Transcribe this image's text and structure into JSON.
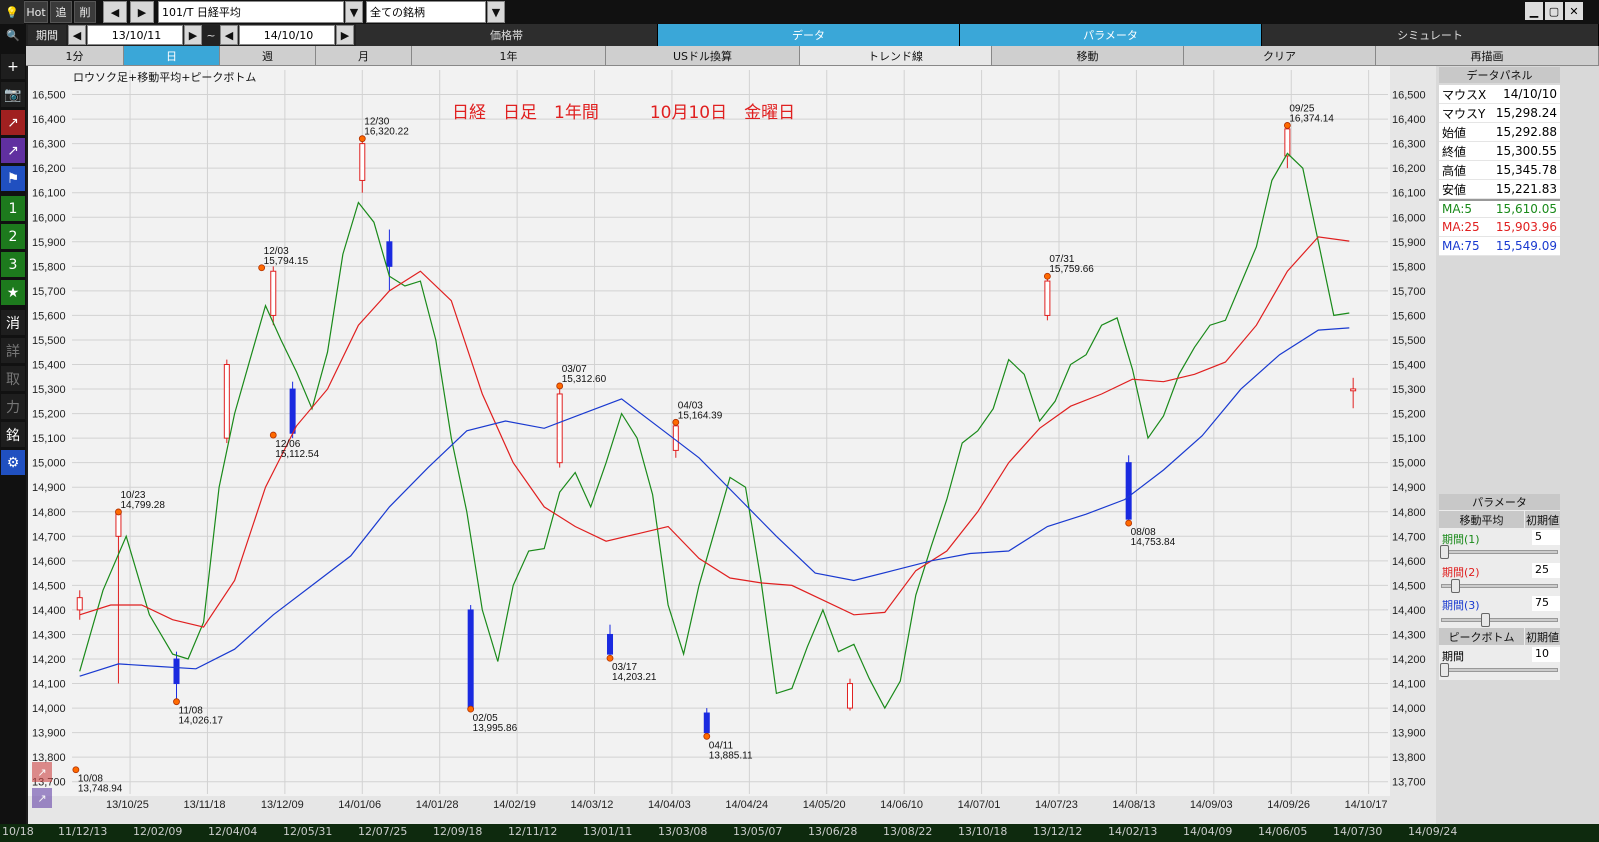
{
  "toolbar": {
    "hot": "Hot",
    "add": "追",
    "del": "削",
    "symbol": "101/T 日経平均",
    "universe": "全ての銘柄",
    "period_label": "期間",
    "date_from": "13/10/11",
    "tilde": "~",
    "date_to": "14/10/10"
  },
  "tabs_top": [
    "価格帯",
    "データ",
    "パラメータ",
    "シミュレート"
  ],
  "tabs_second": [
    "1分",
    "日",
    "週",
    "月",
    "1年",
    "USドル換算",
    "トレンド線",
    "移動",
    "クリア",
    "再描画"
  ],
  "side_buttons": [
    "1",
    "2",
    "3",
    "★",
    "消",
    "詳",
    "取",
    "力",
    "銘"
  ],
  "chart_title": "ロウソク足+移動平均+ピークボトム",
  "chart_caption": "日経　日足　1年間　　　10月10日　金曜日",
  "data_panel": {
    "title": "データパネル",
    "rows": [
      {
        "label": "マウスX",
        "value": "14/10/10"
      },
      {
        "label": "マウスY",
        "value": "15,298.24"
      },
      {
        "label": "始値",
        "value": "15,292.88"
      },
      {
        "label": "終値",
        "value": "15,300.55"
      },
      {
        "label": "高値",
        "value": "15,345.78"
      },
      {
        "label": "安値",
        "value": "15,221.83"
      },
      {
        "label": "MA:5",
        "value": "15,610.05",
        "color": "#1a8a1a"
      },
      {
        "label": "MA:25",
        "value": "15,903.96",
        "color": "#e02020"
      },
      {
        "label": "MA:75",
        "value": "15,549.09",
        "color": "#1a3ad0"
      }
    ]
  },
  "params": {
    "title": "パラメータ",
    "ma_header": "移動平均",
    "init": "初期値",
    "p1": "期間(1)",
    "v1": "5",
    "p2": "期間(2)",
    "v2": "25",
    "p3": "期間(3)",
    "v3": "75",
    "pb_header": "ピークボトム",
    "pb_period": "期間",
    "pb_value": "10",
    "slider_levels": {
      "p1": 0.0,
      "p2": 0.1,
      "p3": 0.38,
      "pb": 0.0
    }
  },
  "bottom_dates": [
    "10/18",
    "11/12/13",
    "12/02/09",
    "12/04/04",
    "12/05/31",
    "12/07/25",
    "12/09/18",
    "12/11/12",
    "13/01/11",
    "13/03/08",
    "13/05/07",
    "13/06/28",
    "13/08/22",
    "13/10/18",
    "13/12/12",
    "14/02/13",
    "14/04/09",
    "14/06/05",
    "14/07/30",
    "14/09/24"
  ],
  "chart_data": {
    "type": "line",
    "title": "ロウソク足+移動平均+ピークボトム",
    "ylim": [
      13650,
      16600
    ],
    "y_ticks": [
      13700,
      13800,
      13900,
      14000,
      14100,
      14200,
      14300,
      14400,
      14500,
      14600,
      14700,
      14800,
      14900,
      15000,
      15100,
      15200,
      15300,
      15400,
      15500,
      15600,
      15700,
      15800,
      15900,
      16000,
      16100,
      16200,
      16300,
      16400,
      16500
    ],
    "y_tick_labels": [
      "13,700",
      "13,800",
      "13,900",
      "14,000",
      "14,100",
      "14,200",
      "14,300",
      "14,400",
      "14,500",
      "14,600",
      "14,700",
      "14,800",
      "14,900",
      "15,000",
      "15,100",
      "15,200",
      "15,300",
      "15,400",
      "15,500",
      "15,600",
      "15,700",
      "15,800",
      "15,900",
      "16,000",
      "16,100",
      "16,200",
      "16,300",
      "16,400",
      "16,500"
    ],
    "x_ticks": [
      "13/10/25",
      "13/11/18",
      "13/12/09",
      "14/01/06",
      "14/01/28",
      "14/02/19",
      "14/03/12",
      "14/04/03",
      "14/04/24",
      "14/05/20",
      "14/06/10",
      "14/07/01",
      "14/07/23",
      "14/08/13",
      "14/09/03",
      "14/09/26",
      "14/10/17"
    ],
    "x_tick_index": [
      13,
      33,
      53,
      73,
      93,
      113,
      133,
      153,
      173,
      193,
      213,
      233,
      253,
      273,
      293,
      313,
      333
    ],
    "series": [
      {
        "name": "MA:5",
        "color": "#1a8a1a",
        "points": [
          [
            0,
            14150
          ],
          [
            6,
            14480
          ],
          [
            12,
            14700
          ],
          [
            18,
            14380
          ],
          [
            24,
            14220
          ],
          [
            28,
            14200
          ],
          [
            32,
            14350
          ],
          [
            36,
            14900
          ],
          [
            40,
            15200
          ],
          [
            44,
            15420
          ],
          [
            48,
            15640
          ],
          [
            52,
            15500
          ],
          [
            56,
            15370
          ],
          [
            60,
            15220
          ],
          [
            64,
            15450
          ],
          [
            68,
            15850
          ],
          [
            72,
            16060
          ],
          [
            76,
            15980
          ],
          [
            80,
            15760
          ],
          [
            84,
            15720
          ],
          [
            88,
            15740
          ],
          [
            92,
            15500
          ],
          [
            96,
            15100
          ],
          [
            100,
            14800
          ],
          [
            104,
            14400
          ],
          [
            108,
            14190
          ],
          [
            112,
            14500
          ],
          [
            116,
            14640
          ],
          [
            120,
            14650
          ],
          [
            124,
            14880
          ],
          [
            128,
            14960
          ],
          [
            132,
            14820
          ],
          [
            136,
            15000
          ],
          [
            140,
            15200
          ],
          [
            144,
            15100
          ],
          [
            148,
            14870
          ],
          [
            152,
            14420
          ],
          [
            156,
            14220
          ],
          [
            160,
            14500
          ],
          [
            164,
            14720
          ],
          [
            168,
            14940
          ],
          [
            172,
            14900
          ],
          [
            176,
            14520
          ],
          [
            180,
            14060
          ],
          [
            184,
            14080
          ],
          [
            188,
            14250
          ],
          [
            192,
            14400
          ],
          [
            196,
            14230
          ],
          [
            200,
            14260
          ],
          [
            204,
            14120
          ],
          [
            208,
            14000
          ],
          [
            212,
            14110
          ],
          [
            216,
            14460
          ],
          [
            220,
            14660
          ],
          [
            224,
            14850
          ],
          [
            228,
            15080
          ],
          [
            232,
            15130
          ],
          [
            236,
            15220
          ],
          [
            240,
            15420
          ],
          [
            244,
            15360
          ],
          [
            248,
            15170
          ],
          [
            252,
            15250
          ],
          [
            256,
            15400
          ],
          [
            260,
            15440
          ],
          [
            264,
            15560
          ],
          [
            268,
            15590
          ],
          [
            272,
            15380
          ],
          [
            276,
            15100
          ],
          [
            280,
            15190
          ],
          [
            284,
            15360
          ],
          [
            288,
            15470
          ],
          [
            292,
            15560
          ],
          [
            296,
            15580
          ],
          [
            300,
            15730
          ],
          [
            304,
            15880
          ],
          [
            308,
            16150
          ],
          [
            312,
            16260
          ],
          [
            316,
            16200
          ],
          [
            320,
            15900
          ],
          [
            324,
            15600
          ],
          [
            328,
            15610
          ]
        ]
      },
      {
        "name": "MA:25",
        "color": "#e02020",
        "points": [
          [
            0,
            14380
          ],
          [
            8,
            14420
          ],
          [
            16,
            14420
          ],
          [
            24,
            14360
          ],
          [
            32,
            14330
          ],
          [
            40,
            14520
          ],
          [
            48,
            14900
          ],
          [
            56,
            15150
          ],
          [
            64,
            15300
          ],
          [
            72,
            15560
          ],
          [
            80,
            15700
          ],
          [
            88,
            15780
          ],
          [
            96,
            15660
          ],
          [
            104,
            15280
          ],
          [
            112,
            15000
          ],
          [
            120,
            14820
          ],
          [
            128,
            14740
          ],
          [
            136,
            14680
          ],
          [
            144,
            14710
          ],
          [
            152,
            14740
          ],
          [
            160,
            14610
          ],
          [
            168,
            14530
          ],
          [
            176,
            14510
          ],
          [
            184,
            14500
          ],
          [
            192,
            14440
          ],
          [
            200,
            14380
          ],
          [
            208,
            14390
          ],
          [
            216,
            14560
          ],
          [
            224,
            14640
          ],
          [
            232,
            14800
          ],
          [
            240,
            15000
          ],
          [
            248,
            15140
          ],
          [
            256,
            15230
          ],
          [
            264,
            15280
          ],
          [
            272,
            15340
          ],
          [
            280,
            15330
          ],
          [
            288,
            15360
          ],
          [
            296,
            15410
          ],
          [
            304,
            15560
          ],
          [
            312,
            15780
          ],
          [
            320,
            15920
          ],
          [
            328,
            15903
          ]
        ]
      },
      {
        "name": "MA:75",
        "color": "#1a3ad0",
        "points": [
          [
            0,
            14130
          ],
          [
            10,
            14180
          ],
          [
            20,
            14170
          ],
          [
            30,
            14160
          ],
          [
            40,
            14240
          ],
          [
            50,
            14380
          ],
          [
            60,
            14500
          ],
          [
            70,
            14620
          ],
          [
            80,
            14820
          ],
          [
            90,
            14980
          ],
          [
            100,
            15130
          ],
          [
            110,
            15170
          ],
          [
            120,
            15140
          ],
          [
            130,
            15200
          ],
          [
            140,
            15260
          ],
          [
            150,
            15140
          ],
          [
            160,
            15020
          ],
          [
            170,
            14860
          ],
          [
            180,
            14700
          ],
          [
            190,
            14550
          ],
          [
            200,
            14520
          ],
          [
            210,
            14560
          ],
          [
            220,
            14600
          ],
          [
            230,
            14630
          ],
          [
            240,
            14640
          ],
          [
            250,
            14740
          ],
          [
            260,
            14790
          ],
          [
            270,
            14850
          ],
          [
            280,
            14970
          ],
          [
            290,
            15110
          ],
          [
            300,
            15300
          ],
          [
            310,
            15440
          ],
          [
            320,
            15540
          ],
          [
            328,
            15549
          ]
        ]
      }
    ],
    "candles": [
      {
        "i": 0,
        "o": 14400,
        "c": 14450,
        "h": 14480,
        "l": 14360
      },
      {
        "i": 10,
        "o": 14700,
        "c": 14800,
        "h": 14810,
        "l": 14100
      },
      {
        "i": 25,
        "o": 14200,
        "c": 14100,
        "h": 14230,
        "l": 14020
      },
      {
        "i": 38,
        "o": 15100,
        "c": 15400,
        "h": 15420,
        "l": 15080
      },
      {
        "i": 50,
        "o": 15600,
        "c": 15780,
        "h": 15800,
        "l": 15560
      },
      {
        "i": 55,
        "o": 15300,
        "c": 15120,
        "h": 15330,
        "l": 15100
      },
      {
        "i": 73,
        "o": 16150,
        "c": 16300,
        "h": 16320,
        "l": 16100
      },
      {
        "i": 80,
        "o": 15900,
        "c": 15800,
        "h": 15950,
        "l": 15700
      },
      {
        "i": 101,
        "o": 14400,
        "c": 14000,
        "h": 14420,
        "l": 13990
      },
      {
        "i": 124,
        "o": 15000,
        "c": 15280,
        "h": 15310,
        "l": 14980
      },
      {
        "i": 137,
        "o": 14300,
        "c": 14220,
        "h": 14340,
        "l": 14200
      },
      {
        "i": 154,
        "o": 15050,
        "c": 15150,
        "h": 15164,
        "l": 15020
      },
      {
        "i": 162,
        "o": 13980,
        "c": 13900,
        "h": 14000,
        "l": 13885
      },
      {
        "i": 199,
        "o": 14000,
        "c": 14100,
        "h": 14120,
        "l": 13990
      },
      {
        "i": 250,
        "o": 15600,
        "c": 15740,
        "h": 15760,
        "l": 15580
      },
      {
        "i": 271,
        "o": 15000,
        "c": 14770,
        "h": 15030,
        "l": 14754
      },
      {
        "i": 312,
        "o": 16250,
        "c": 16360,
        "h": 16374,
        "l": 16200
      },
      {
        "i": 329,
        "o": 15292.88,
        "c": 15300.55,
        "h": 15345.78,
        "l": 15221.83
      }
    ],
    "peaks": [
      {
        "i": -1,
        "v": 13748.94,
        "date": "10/08",
        "label": "13,748.94"
      },
      {
        "i": 10,
        "v": 14799.28,
        "date": "10/23",
        "label": "14,799.28"
      },
      {
        "i": 25,
        "v": 14026.17,
        "date": "11/08",
        "label": "14,026.17"
      },
      {
        "i": 47,
        "v": 15794.15,
        "date": "12/03",
        "label": "15,794.15"
      },
      {
        "i": 50,
        "v": 15112.54,
        "date": "12/06",
        "label": "15,112.54"
      },
      {
        "i": 73,
        "v": 16320.22,
        "date": "12/30",
        "label": "16,320.22"
      },
      {
        "i": 101,
        "v": 13995.86,
        "date": "02/05",
        "label": "13,995.86"
      },
      {
        "i": 124,
        "v": 15312.6,
        "date": "03/07",
        "label": "15,312.60"
      },
      {
        "i": 137,
        "v": 14203.21,
        "date": "03/17",
        "label": "14,203.21"
      },
      {
        "i": 154,
        "v": 15164.39,
        "date": "04/03",
        "label": "15,164.39"
      },
      {
        "i": 162,
        "v": 13885.11,
        "date": "04/11",
        "label": "13,885.11"
      },
      {
        "i": 250,
        "v": 15759.66,
        "date": "07/31",
        "label": "15,759.66"
      },
      {
        "i": 271,
        "v": 14753.84,
        "date": "08/08",
        "label": "14,753.84"
      },
      {
        "i": 312,
        "v": 16374.14,
        "date": "09/25",
        "label": "16,374.14"
      }
    ]
  }
}
